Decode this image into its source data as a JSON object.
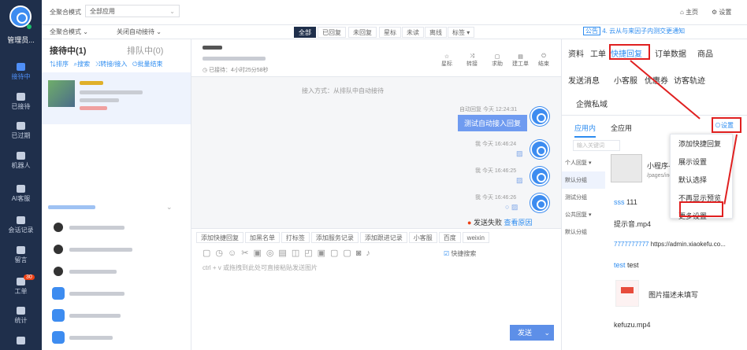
{
  "rail": {
    "username": "管理员...",
    "items": [
      {
        "label": "接待中",
        "active": true
      },
      {
        "label": "已接待"
      },
      {
        "label": "已过期"
      },
      {
        "label": "机器人"
      },
      {
        "label": "AI客服"
      },
      {
        "label": "会话记录"
      },
      {
        "label": "留言"
      },
      {
        "label": "工单",
        "badge": "30"
      },
      {
        "label": "统计"
      },
      {
        "label": ""
      }
    ]
  },
  "topbar": {
    "mode": "全聚合模式",
    "app": "全部应用",
    "home": "主页",
    "settings": "设置"
  },
  "filterbar": {
    "mode": "全聚合模式",
    "auto": "关闭自动接待",
    "filters": [
      "全部",
      "已回复",
      "未回复",
      "星标",
      "未读",
      "离线",
      "标签 ▾"
    ]
  },
  "left": {
    "tab_active": "接待中(1)",
    "tab_other": "排队中(0)",
    "actions": [
      "排序",
      "搜索",
      "转接/接入",
      "批量结束"
    ]
  },
  "chat": {
    "header_timer": "已接待：4小时25分58秒",
    "header_tools": [
      "星标",
      "转接",
      "求助",
      "建工单",
      "结束"
    ],
    "system_msg": "接入方式：从排队中自动接待",
    "msg1_meta": "自动回复  今天 12:24:31",
    "msg1_text": "测试自动接入回复",
    "msg2_meta": "我  今天 16:46:24",
    "msg3_meta": "我  今天 16:46:25",
    "msg4_meta": "我  今天 16:46:26",
    "send_fail": "发送失败",
    "view_reason": "查看原因",
    "toolbar": [
      "添加快捷回复",
      "加黑名单",
      "打标签",
      "添加服务记录",
      "添加跟进记录",
      "小客服",
      "百度",
      "weixin"
    ],
    "quick_search": "快捷搜索",
    "input_placeholder": "ctrl + v 或拖拽到此处可直接粘贴发送图片",
    "send": "发送"
  },
  "right": {
    "notice": "公告",
    "notice_text": "4. 云从与来因子内测交更通知",
    "tabs_row1": [
      "资料",
      "工单",
      "快捷回复",
      "订单数据",
      "商品"
    ],
    "tabs_row2": [
      "发送消息",
      "小客服",
      "优惠券",
      "访客轨迹"
    ],
    "tabs_row3": [
      "企微私域"
    ],
    "subtabs": [
      "应用内",
      "全应用"
    ],
    "settings": "设置",
    "search_placeholder": "输入关键词",
    "groups": [
      "个人回复 ▾",
      "默认分组",
      "测试分组",
      "公共回复 ▾",
      "默认分组"
    ],
    "miniprogram": "小程序-",
    "minipath": "/pages/ind",
    "items": [
      {
        "title": "sss",
        "text": "111"
      },
      {
        "title": "",
        "text": "提示音.mp4"
      },
      {
        "title": "7777777777",
        "text": "https://admin.xiaokefu.co..."
      },
      {
        "title": "test",
        "text": "test"
      },
      {
        "title": "",
        "text": "图片描述未填写"
      },
      {
        "title": "",
        "text": "kefuzu.mp4"
      }
    ],
    "menu": [
      "添加快捷回复",
      "展示设置",
      "默认选择",
      "不再显示预览",
      "更多设置"
    ]
  }
}
